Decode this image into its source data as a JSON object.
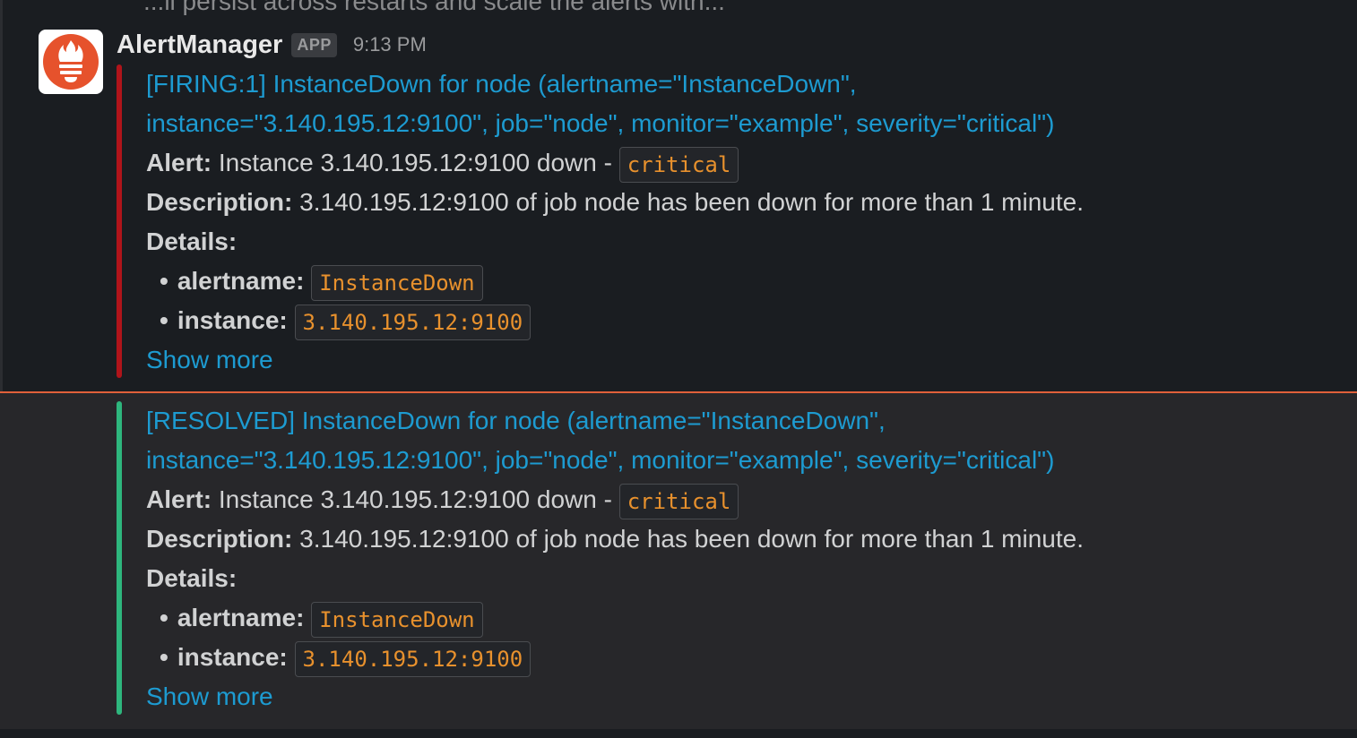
{
  "top_text": "...ll persist across restarts and scale the alerts with...",
  "message": {
    "sender": "AlertManager",
    "badge": "APP",
    "time": "9:13 PM",
    "avatar_icon": "prometheus-icon"
  },
  "alerts": [
    {
      "status_color": "#b0141a",
      "title_line1": "[FIRING:1] InstanceDown for node (alertname=\"InstanceDown\",",
      "title_line2": "instance=\"3.140.195.12:9100\", job=\"node\", monitor=\"example\", severity=\"critical\")",
      "alert_label": "Alert:",
      "alert_text": "Instance 3.140.195.12:9100 down -",
      "alert_severity": "critical",
      "description_label": "Description:",
      "description_text": "3.140.195.12:9100 of job node has been down for more than 1 minute.",
      "details_label": "Details:",
      "details": [
        {
          "key": "alertname:",
          "value": "InstanceDown"
        },
        {
          "key": "instance:",
          "value": "3.140.195.12:9100"
        }
      ],
      "show_more": "Show more"
    },
    {
      "status_color": "#2eb67d",
      "title_line1": "[RESOLVED] InstanceDown for node (alertname=\"InstanceDown\",",
      "title_line2": "instance=\"3.140.195.12:9100\", job=\"node\", monitor=\"example\", severity=\"critical\")",
      "alert_label": "Alert:",
      "alert_text": "Instance 3.140.195.12:9100 down -",
      "alert_severity": "critical",
      "description_label": "Description:",
      "description_text": "3.140.195.12:9100 of job node has been down for more than 1 minute.",
      "details_label": "Details:",
      "details": [
        {
          "key": "alertname:",
          "value": "InstanceDown"
        },
        {
          "key": "instance:",
          "value": "3.140.195.12:9100"
        }
      ],
      "show_more": "Show more"
    }
  ],
  "colors": {
    "link": "#1d9bd1",
    "code": "#e8912d",
    "new_divider": "#e0603a"
  }
}
